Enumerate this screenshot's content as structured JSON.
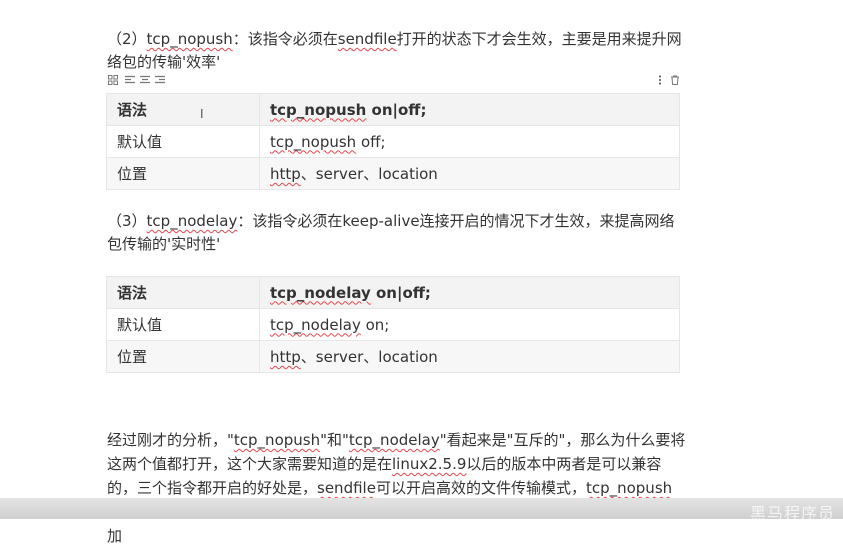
{
  "section2": {
    "num": "（2）",
    "term": "tcp_nopush",
    "text_a": "：该指令必须在",
    "term2": "sendfile",
    "text_b": "打开的状态下才会生效，主要是用来提升网络包的传输'效率'"
  },
  "toolbar": {
    "icons": [
      "grid-icon",
      "align-left-icon",
      "align-center-icon",
      "align-right-icon",
      "more-icon",
      "trash-icon"
    ]
  },
  "table1": {
    "head": {
      "label": "语法",
      "value_term": "tcp_nopush",
      "value_rest": " on|off;"
    },
    "rows": [
      {
        "label": "默认值",
        "term": "tcp_nopush",
        "rest": " off;"
      },
      {
        "label": "位置",
        "term": "http",
        "rest": "、server、location"
      }
    ]
  },
  "section3": {
    "num": "（3）",
    "term": "tcp_nodelay",
    "text": "：该指令必须在keep-alive连接开启的情况下才生效，来提高网络包传输的'实时性'"
  },
  "table2": {
    "head": {
      "label": "语法",
      "value_term": "tcp_nodelay",
      "value_rest": " on|off;"
    },
    "rows": [
      {
        "label": "默认值",
        "term": "tcp_nodelay",
        "rest": " on;"
      },
      {
        "label": "位置",
        "term": "http",
        "rest": "、server、location"
      }
    ]
  },
  "analysis": {
    "t1": "经过刚才的分析，\"",
    "k1": "tcp_nopush",
    "t2": "\"和\"",
    "k2": "tcp_nodelay",
    "t3": "\"看起来是\"互斥的\"，那么为什么要将这两个值都打开，这个大家需要知道的是在",
    "k3": "linux2.5.9",
    "t4": "以后的版本中两者是可以兼容的，三个指令都开启的好处是，",
    "k4": "sendfile",
    "t5": "可以开启高效的文件传输模式，",
    "k5": "tcp_nopush",
    "t6": "开启可以确保在发送到客户端之前数据包已经充分\"填满\"，这大大减少了网络开销，并加"
  },
  "watermark": "黑马程序员"
}
